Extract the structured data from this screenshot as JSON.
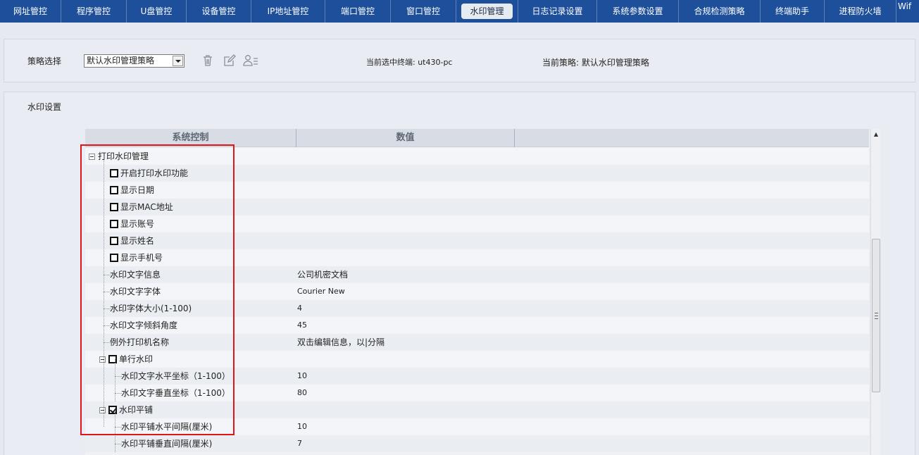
{
  "nav": {
    "tabs": [
      {
        "label": "网址管控",
        "active": false
      },
      {
        "label": "程序管控",
        "active": false
      },
      {
        "label": "U盘管控",
        "active": false
      },
      {
        "label": "设备管控",
        "active": false
      },
      {
        "label": "IP地址管控",
        "active": false
      },
      {
        "label": "端口管控",
        "active": false
      },
      {
        "label": "窗口管控",
        "active": false
      },
      {
        "label": "水印管理",
        "active": true
      },
      {
        "label": "日志记录设置",
        "active": false
      },
      {
        "label": "系统参数设置",
        "active": false
      },
      {
        "label": "合规检测策略",
        "active": false
      },
      {
        "label": "终端助手",
        "active": false
      },
      {
        "label": "进程防火墙",
        "active": false
      },
      {
        "label": "Wif",
        "active": false
      }
    ]
  },
  "policy": {
    "label": "策略选择",
    "selected": "默认水印管理策略",
    "current_terminal": "当前选中终端: ut430-pc",
    "current_policy": "当前策略: 默认水印管理策略",
    "icons": [
      "trash-icon",
      "edit-icon",
      "user-list-icon"
    ]
  },
  "settings": {
    "title": "水印设置",
    "columns": [
      "系统控制",
      "数值"
    ],
    "rows": [
      {
        "name": "打印水印管理",
        "value": "",
        "level": 0,
        "expander": true,
        "checkbox": null
      },
      {
        "name": "开启打印水印功能",
        "value": "",
        "level": 1,
        "expander": false,
        "checkbox": false
      },
      {
        "name": "显示日期",
        "value": "",
        "level": 1,
        "expander": false,
        "checkbox": false
      },
      {
        "name": "显示MAC地址",
        "value": "",
        "level": 1,
        "expander": false,
        "checkbox": false
      },
      {
        "name": "显示账号",
        "value": "",
        "level": 1,
        "expander": false,
        "checkbox": false
      },
      {
        "name": "显示姓名",
        "value": "",
        "level": 1,
        "expander": false,
        "checkbox": false
      },
      {
        "name": "显示手机号",
        "value": "",
        "level": 1,
        "expander": false,
        "checkbox": false
      },
      {
        "name": "水印文字信息",
        "value": "公司机密文档",
        "level": 1,
        "expander": false,
        "checkbox": null
      },
      {
        "name": "水印文字字体",
        "value": "Courier New",
        "level": 1,
        "expander": false,
        "checkbox": null
      },
      {
        "name": "水印字体大小(1-100)",
        "value": "4",
        "level": 1,
        "expander": false,
        "checkbox": null
      },
      {
        "name": "水印文字倾斜角度",
        "value": "45",
        "level": 1,
        "expander": false,
        "checkbox": null
      },
      {
        "name": "例外打印机名称",
        "value": "双击编辑信息，以|分隔",
        "level": 1,
        "expander": false,
        "checkbox": null
      },
      {
        "name": "单行水印",
        "value": "",
        "level": 1,
        "expander": true,
        "checkbox": false
      },
      {
        "name": "水印文字水平坐标（1-100）",
        "value": "10",
        "level": 2,
        "expander": false,
        "checkbox": null
      },
      {
        "name": "水印文字垂直坐标（1-100）",
        "value": "80",
        "level": 2,
        "expander": false,
        "checkbox": null
      },
      {
        "name": "水印平铺",
        "value": "",
        "level": 1,
        "expander": true,
        "checkbox": true
      },
      {
        "name": "水印平铺水平间隔(厘米)",
        "value": "10",
        "level": 2,
        "expander": false,
        "checkbox": null
      },
      {
        "name": "水印平铺垂直间隔(厘米)",
        "value": "7",
        "level": 2,
        "expander": false,
        "checkbox": null
      }
    ]
  },
  "colors": {
    "nav_bg": "#1d4f9b",
    "highlight": "#e0151c"
  }
}
